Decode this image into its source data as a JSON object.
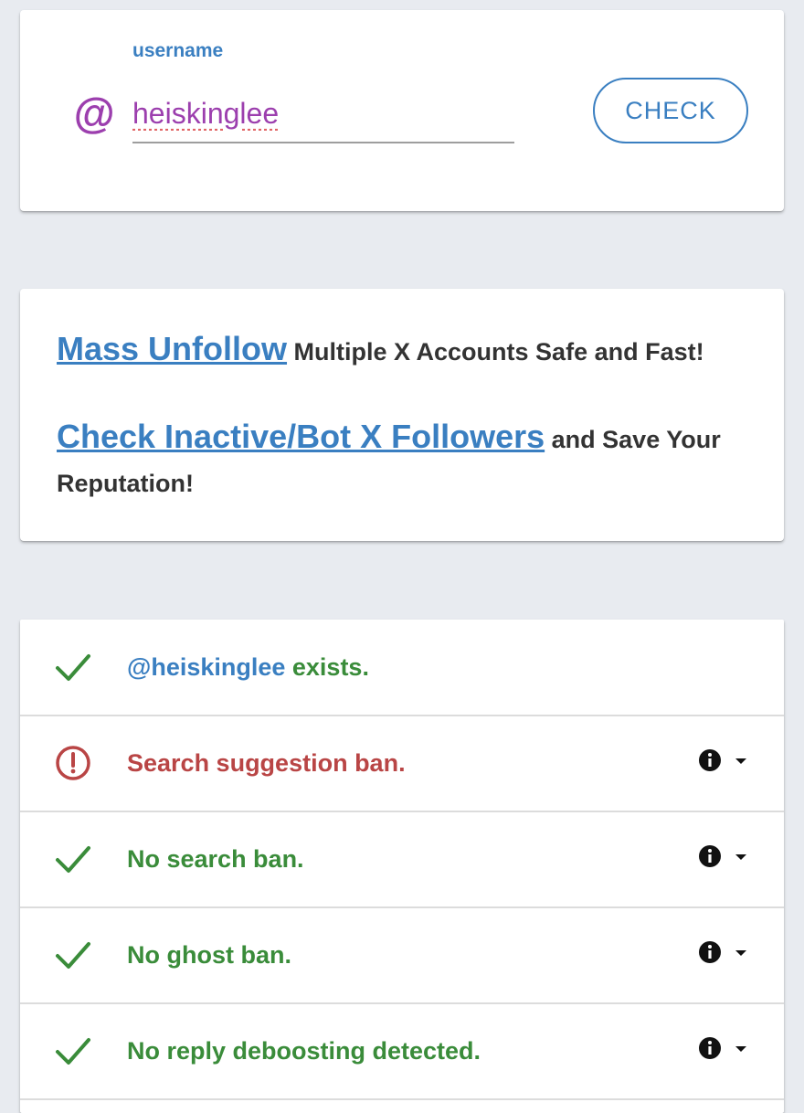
{
  "search": {
    "label": "username",
    "at_symbol": "@",
    "value": "heiskinglee",
    "button_label": "CHECK"
  },
  "promo": {
    "line1_link": "Mass Unfollow",
    "line1_text": " Multiple X Accounts Safe and Fast!",
    "line2_link": "Check Inactive/Bot X Followers",
    "line2_text": " and Save Your Reputation!"
  },
  "results": [
    {
      "status": "ok",
      "username": "@heiskinglee",
      "text": " exists."
    },
    {
      "status": "warning",
      "text": "Search suggestion ban."
    },
    {
      "status": "ok",
      "text": "No search ban."
    },
    {
      "status": "ok",
      "text": "No ghost ban."
    },
    {
      "status": "ok",
      "text": "No reply deboosting detected."
    }
  ],
  "colors": {
    "accent": "#3a7fc1",
    "username": "#9c3fae",
    "ok": "#3a8c3a",
    "warning": "#b94545",
    "background": "#e8ebf0"
  },
  "icons": {
    "ok": "checkmark-icon",
    "warning": "exclamation-circle-icon",
    "info": "info-icon",
    "dropdown": "caret-down-icon"
  }
}
